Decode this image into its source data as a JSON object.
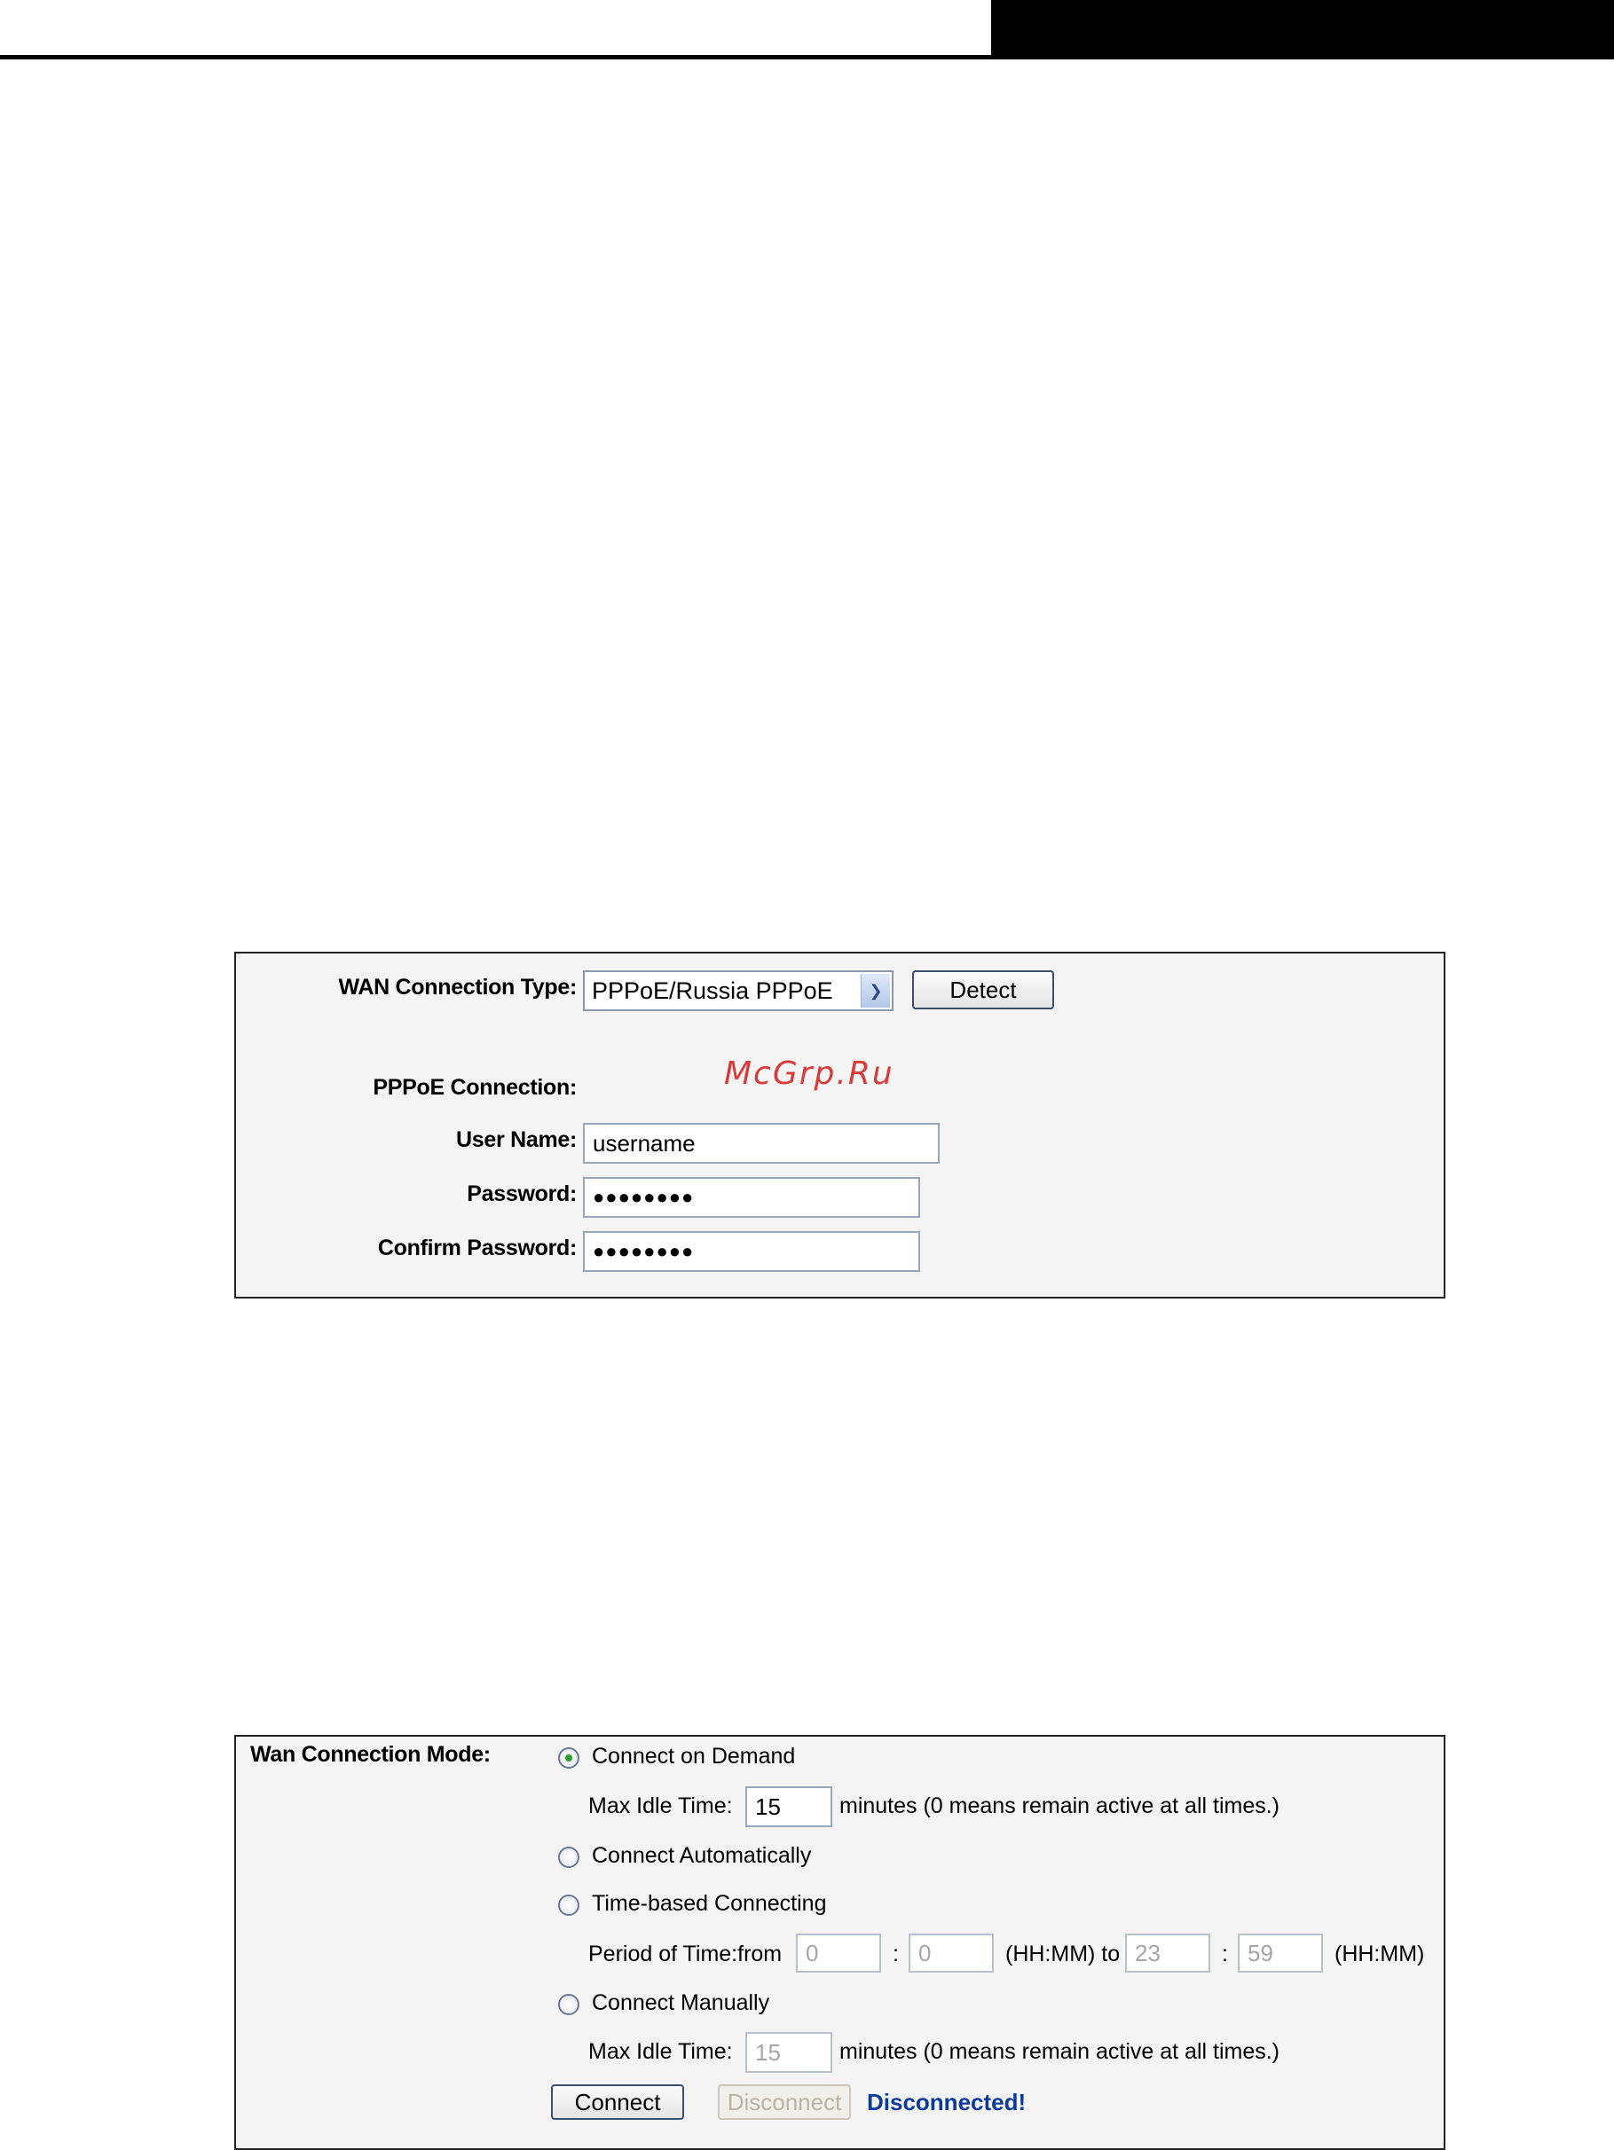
{
  "watermark": "McGrp.Ru",
  "wan_type_panel": {
    "wan_connection_type_label": "WAN Connection Type:",
    "wan_connection_type_value": "PPPoE/Russia PPPoE",
    "detect_button": "Detect",
    "pppoe_connection_label": "PPPoE Connection:",
    "user_name_label": "User Name:",
    "user_name_value": "username",
    "password_label": "Password:",
    "password_value": "●●●●●●●●",
    "confirm_password_label": "Confirm Password:",
    "confirm_password_value": "●●●●●●●●"
  },
  "mode_panel": {
    "mode_label": "Wan Connection Mode:",
    "connect_on_demand": "Connect on Demand",
    "max_idle_label_1": "Max Idle Time:",
    "max_idle_value_1": "15",
    "max_idle_hint_1": "minutes (0 means remain active at all times.)",
    "connect_automatically": "Connect Automatically",
    "time_based": "Time-based Connecting",
    "period_label": "Period of Time:from",
    "from_hh": "0",
    "colon_1": ":",
    "from_mm": "0",
    "hhmm_to": "(HH:MM) to",
    "to_hh": "23",
    "colon_2": ":",
    "to_mm": "59",
    "hhmm_end": "(HH:MM)",
    "connect_manually": "Connect Manually",
    "max_idle_label_2": "Max Idle Time:",
    "max_idle_value_2": "15",
    "max_idle_hint_2": "minutes (0 means remain active at all times.)",
    "connect_button": "Connect",
    "disconnect_button": "Disconnect",
    "status_text": "Disconnected!"
  },
  "colors": {
    "status": "#0b3b9a",
    "watermark": "#d93b3b",
    "radio_selected": "#2a9a2a"
  }
}
